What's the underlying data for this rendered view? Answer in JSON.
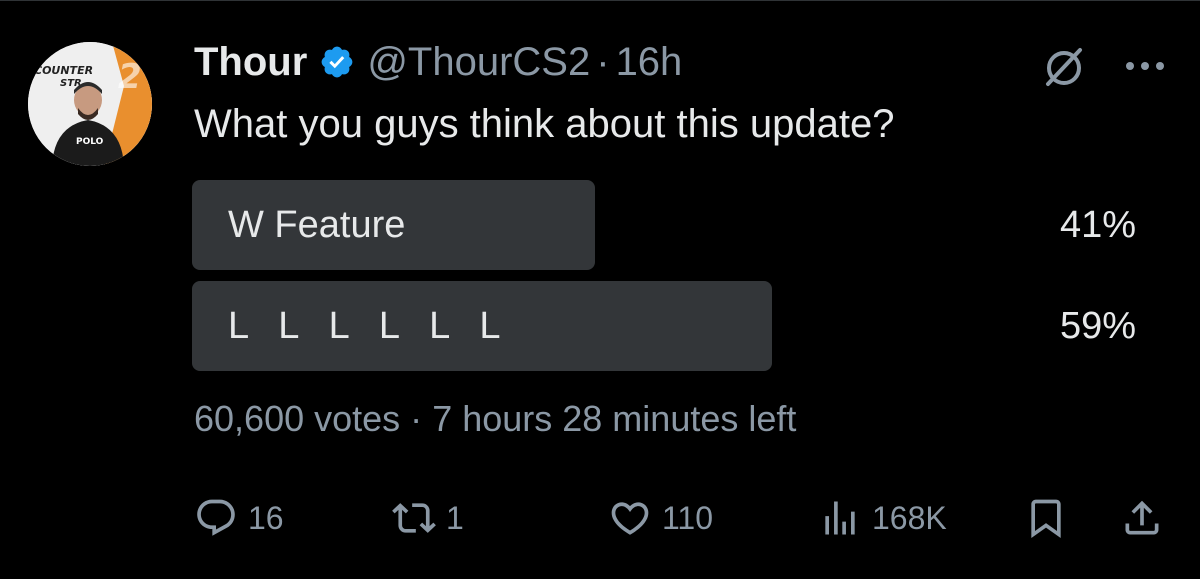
{
  "tweet": {
    "author_name": "Thour",
    "handle": "@ThourCS2",
    "separator": "·",
    "time_ago": "16h",
    "text": "What you guys think about this update?",
    "avatar_text": [
      "COUNTER",
      "STR",
      "POLO"
    ]
  },
  "poll": {
    "options": [
      {
        "label": "W Feature",
        "percent_text": "41%",
        "fraction": 0.41
      },
      {
        "label": "L L L L L L",
        "percent_text": "59%",
        "fraction": 0.59
      }
    ],
    "votes": "60,600 votes",
    "separator": "·",
    "time_left": "7 hours 28 minutes left"
  },
  "actions": {
    "replies": "16",
    "reposts": "1",
    "likes": "110",
    "views": "168K"
  },
  "icons": {
    "verified": "verified-badge-icon",
    "grok": "grok-icon",
    "more": "more-icon",
    "reply": "reply-icon",
    "repost": "repost-icon",
    "like": "heart-icon",
    "views": "views-icon",
    "bookmark": "bookmark-icon",
    "share": "share-icon"
  },
  "colors": {
    "background": "#000000",
    "text": "#e7e9ea",
    "muted": "#8b98a5",
    "poll_fill": "#333639",
    "verified": "#1d9bf0",
    "avatar_accent": "#e98f2e"
  }
}
